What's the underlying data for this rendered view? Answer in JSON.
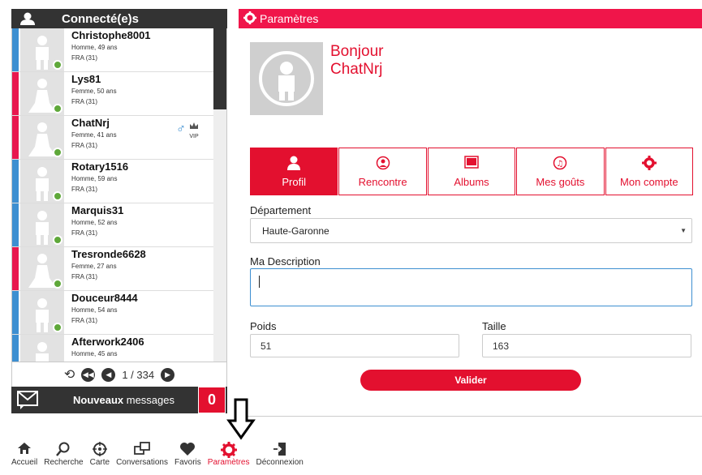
{
  "left_panel": {
    "title": "Connecté(e)s",
    "users": [
      {
        "name": "Christophe8001",
        "details": "Homme, 49 ans",
        "location": "FRA (31)",
        "gender": "m",
        "online": true
      },
      {
        "name": "Lys81",
        "details": "Femme, 50 ans",
        "location": "FRA (31)",
        "gender": "f",
        "online": true
      },
      {
        "name": "ChatNrj",
        "details": "Femme, 41 ans",
        "location": "FRA (31)",
        "gender": "f",
        "online": true,
        "badges": [
          "male-symbol-icon",
          "vip-crown-icon"
        ],
        "vip_label": "VIP"
      },
      {
        "name": "Rotary1516",
        "details": "Homme, 59 ans",
        "location": "FRA (31)",
        "gender": "m",
        "online": true
      },
      {
        "name": "Marquis31",
        "details": "Homme, 52 ans",
        "location": "FRA (31)",
        "gender": "m",
        "online": true
      },
      {
        "name": "Tresronde6628",
        "details": "Femme, 27 ans",
        "location": "FRA (31)",
        "gender": "f",
        "online": true
      },
      {
        "name": "Douceur8444",
        "details": "Homme, 54 ans",
        "location": "FRA (31)",
        "gender": "m",
        "online": true
      },
      {
        "name": "Afterwork2406",
        "details": "Homme, 45 ans",
        "location": "",
        "gender": "m",
        "online": false
      }
    ],
    "pager": {
      "current": "1",
      "total": "334",
      "text": "1 / 334"
    },
    "messages": {
      "bold": "Nouveaux",
      "rest": " messages",
      "count": "0"
    }
  },
  "settings": {
    "title": "Paramètres",
    "greeting_line1": "Bonjour",
    "greeting_line2": "ChatNrj",
    "tabs": [
      {
        "label": "Profil",
        "icon": "user-icon",
        "active": true
      },
      {
        "label": "Rencontre",
        "icon": "rencontre-icon",
        "active": false
      },
      {
        "label": "Albums",
        "icon": "album-icon",
        "active": false
      },
      {
        "label": "Mes goûts",
        "icon": "music-icon",
        "active": false
      },
      {
        "label": "Mon compte",
        "icon": "gear-icon",
        "active": false
      }
    ],
    "departement_label": "Département",
    "departement_value": "Haute-Garonne",
    "description_label": "Ma Description",
    "description_value": "",
    "poids_label": "Poids",
    "poids_value": "51",
    "taille_label": "Taille",
    "taille_value": "163",
    "validate_label": "Valider"
  },
  "nav": [
    {
      "label": "Accueil",
      "icon": "home-icon"
    },
    {
      "label": "Recherche",
      "icon": "search-icon"
    },
    {
      "label": "Carte",
      "icon": "target-icon"
    },
    {
      "label": "Conversations",
      "icon": "chat-icon"
    },
    {
      "label": "Favoris",
      "icon": "heart-icon"
    },
    {
      "label": "Paramètres",
      "icon": "gear-icon",
      "active": true
    },
    {
      "label": "Déconnexion",
      "icon": "logout-icon"
    }
  ],
  "colors": {
    "accent": "#e3102f",
    "header_pink": "#f0154a",
    "male": "#3d8fd1",
    "female": "#e8174e",
    "online": "#5fa83a",
    "dark": "#333333"
  }
}
